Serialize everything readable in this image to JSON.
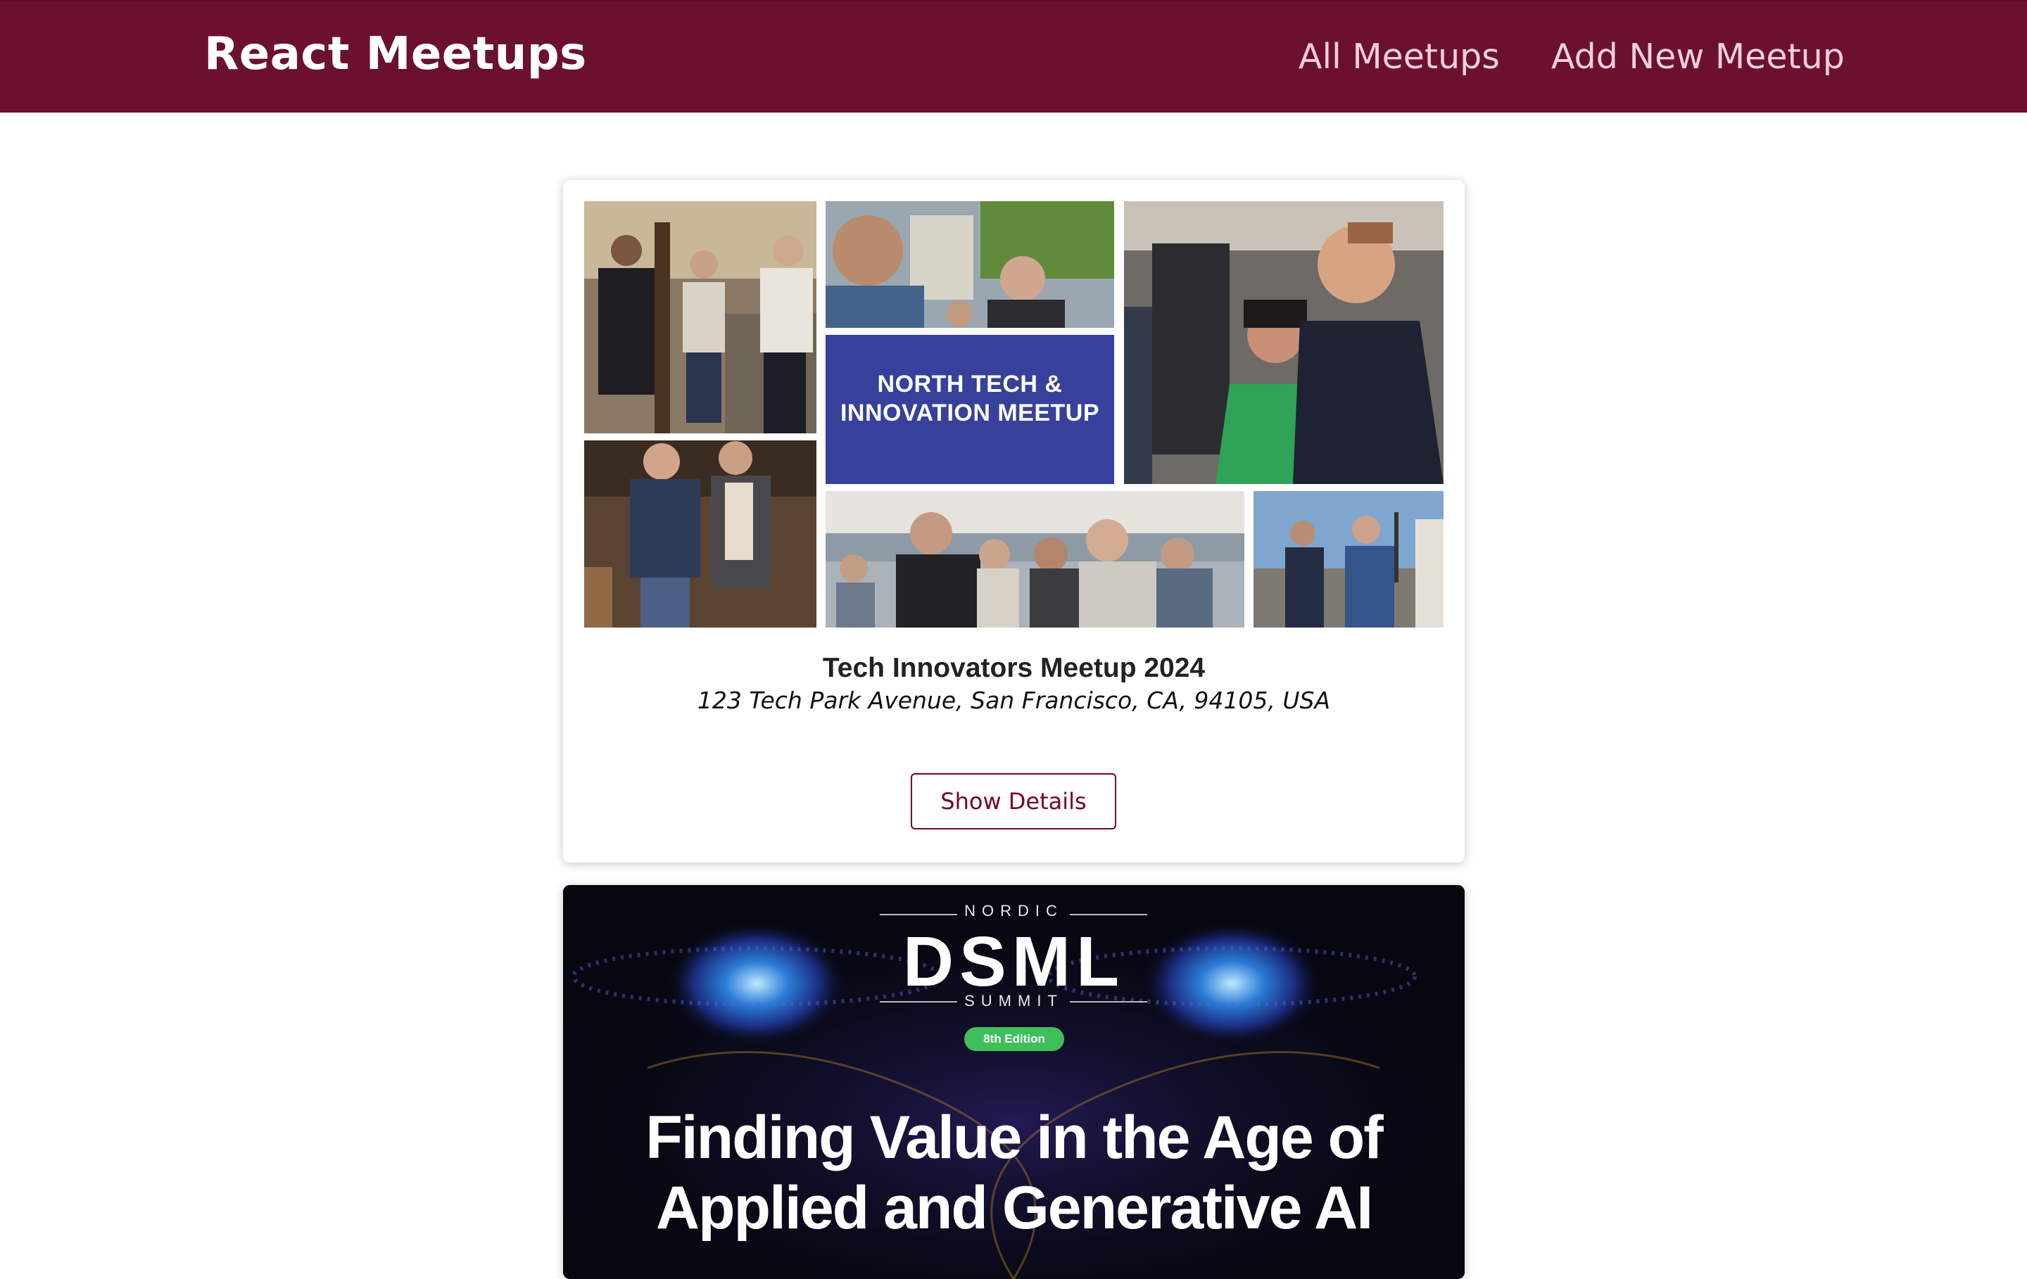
{
  "header": {
    "logo": "React Meetups",
    "nav": [
      {
        "label": "All Meetups"
      },
      {
        "label": "Add New Meetup"
      }
    ]
  },
  "meetups": [
    {
      "banner": "NORTH TECH & INNOVATION MEETUP",
      "title": "Tech Innovators Meetup 2024",
      "address": "123 Tech Park Avenue, San Francisco, CA, 94105, USA",
      "button": "Show Details"
    },
    {
      "poster": {
        "top": "NORDIC",
        "logo": "DSML",
        "sub": "SUMMIT",
        "edition": "8th Edition",
        "headline_1": "Finding Value in the Age of",
        "headline_2": "Applied and Generative AI"
      }
    }
  ],
  "colors": {
    "header_bg": "#6b112f",
    "nav_text": "#f6cfdc",
    "button_border": "#77002e",
    "banner_bg": "#37409a"
  }
}
